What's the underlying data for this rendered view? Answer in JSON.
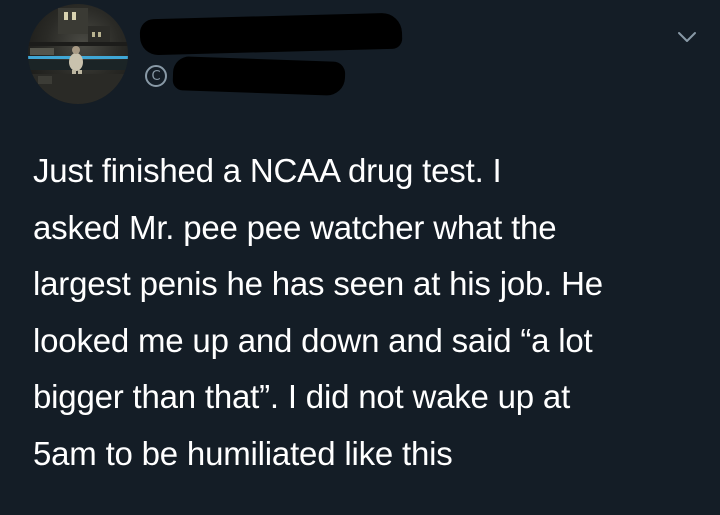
{
  "tweet": {
    "author": {
      "avatar": "avatar-photo",
      "display_name": "",
      "handle": ""
    },
    "icons": {
      "verified": "copyright-like-circle-icon",
      "menu": "chevron-down-icon"
    },
    "text": "Just finished a NCAA drug test. I\nasked Mr. pee pee watcher what the\nlargest penis he has seen at his job. He\nlooked me up and down and said “a lot\nbigger than that”. I did not wake up at\n5am to be humiliated like this"
  },
  "colors": {
    "background": "#141d26",
    "text": "#ffffff",
    "muted": "#8899a6"
  }
}
